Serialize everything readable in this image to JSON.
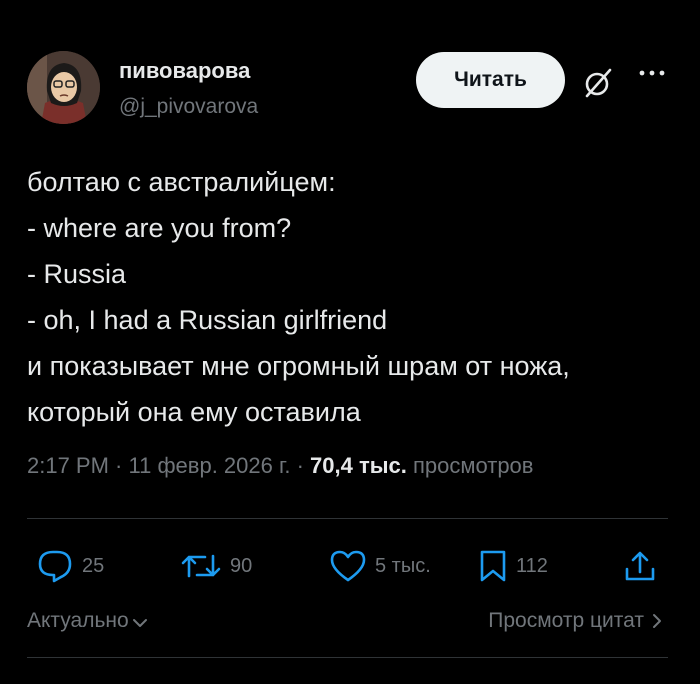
{
  "author": {
    "name": "пивоварова",
    "handle": "@j_pivovarova"
  },
  "follow_label": "Читать",
  "tweet": {
    "lines": [
      "болтаю с австралийцем:",
      "- where are you from?",
      "- Russia",
      "- oh, I had a Russian girlfriend",
      "и показывает мне огромный шрам от ножа,",
      "который она ему оставила"
    ]
  },
  "meta": {
    "time": "2:17 PM",
    "separator": " · ",
    "date": "11 февр. 2026 г.",
    "views_count": "70,4 тыс.",
    "views_label": "просмотров"
  },
  "actions": {
    "replies": "25",
    "reposts": "90",
    "likes": "5 тыс.",
    "bookmarks": "112"
  },
  "footer": {
    "sort_label": "Актуально",
    "quotes_label": "Просмотр цитат"
  },
  "colors": {
    "background": "#000000",
    "text": "#e7e9ea",
    "muted": "#71767b",
    "divider": "#2f3336",
    "button_bg": "#eff3f4"
  },
  "icons": [
    "grok-icon",
    "more-icon",
    "reply-icon",
    "repost-icon",
    "like-icon",
    "bookmark-icon",
    "share-icon",
    "chevron-down-icon",
    "chevron-right-icon"
  ]
}
